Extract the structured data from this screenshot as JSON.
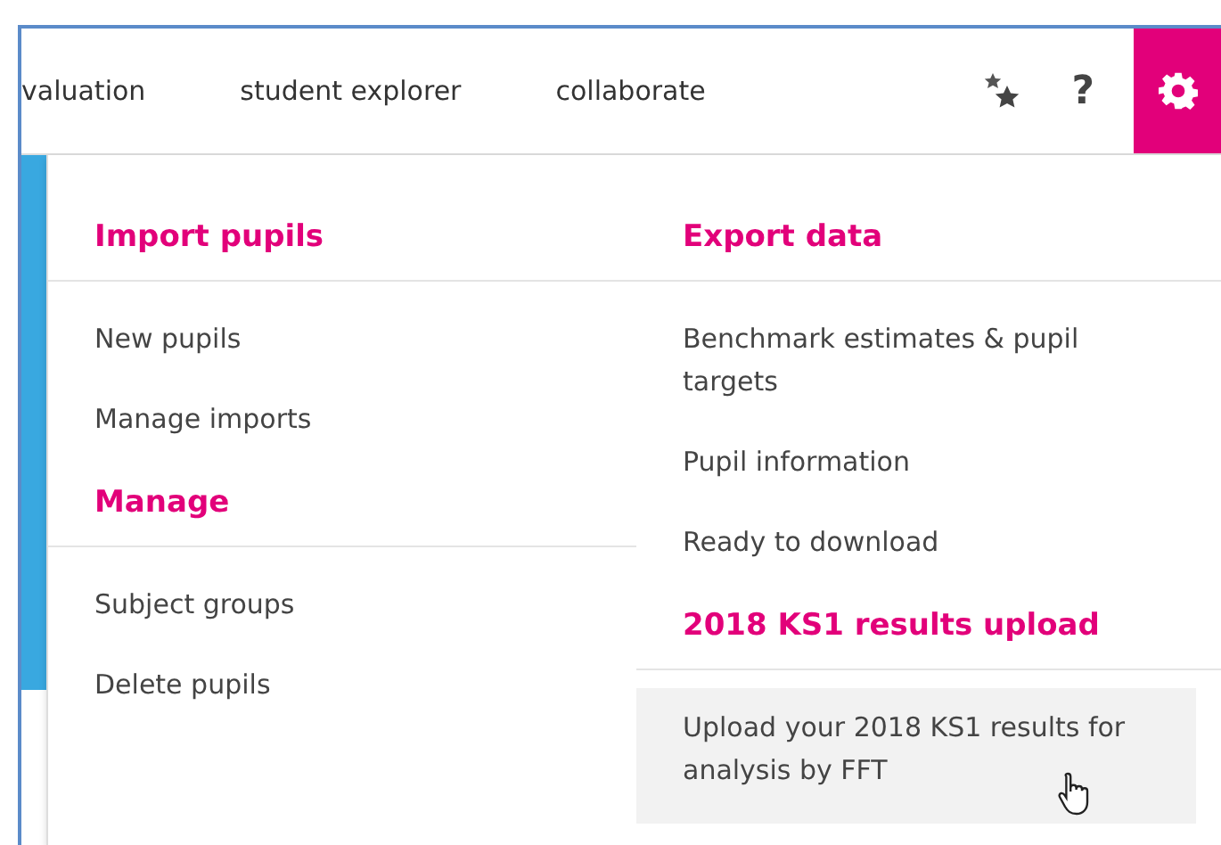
{
  "nav": {
    "links": [
      {
        "label": "valuation"
      },
      {
        "label": "student explorer"
      },
      {
        "label": "collaborate"
      }
    ],
    "help": "?",
    "settings_active": true
  },
  "menu": {
    "columns": [
      {
        "sections": [
          {
            "heading": "Import pupils",
            "items": [
              {
                "label": "New pupils",
                "selected": false
              },
              {
                "label": "Manage imports",
                "selected": false
              }
            ]
          },
          {
            "heading": "Manage",
            "items": [
              {
                "label": "Subject groups",
                "selected": false
              },
              {
                "label": "Delete pupils",
                "selected": false
              }
            ]
          }
        ]
      },
      {
        "sections": [
          {
            "heading": "Export data",
            "items": [
              {
                "label": "Benchmark estimates & pupil targets",
                "selected": false
              },
              {
                "label": "Pupil information",
                "selected": false
              },
              {
                "label": "Ready to download",
                "selected": false
              }
            ]
          },
          {
            "heading": "2018 KS1 results upload",
            "items": [
              {
                "label": "Upload your 2018 KS1 results for analysis by FFT",
                "selected": true
              }
            ]
          }
        ]
      }
    ]
  }
}
